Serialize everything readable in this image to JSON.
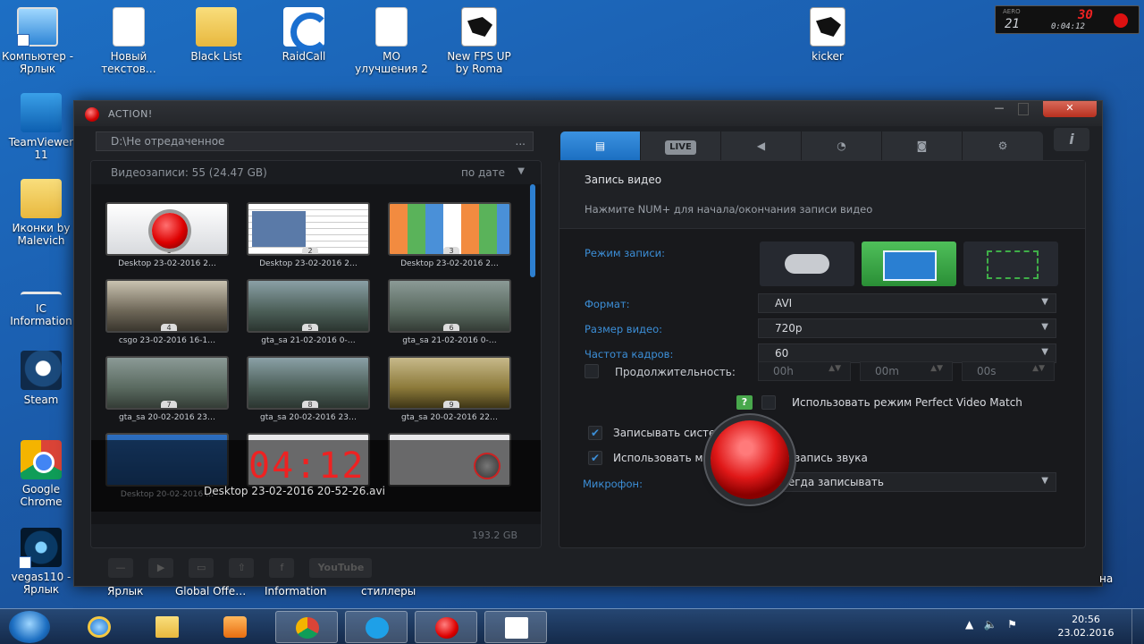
{
  "desktop_icons": [
    {
      "label": "Компьютер -\nЯрлык",
      "icon": "computer-icon"
    },
    {
      "label": "Новый\nтекстов…",
      "icon": "document-icon"
    },
    {
      "label": "Black List",
      "icon": "folder-icon"
    },
    {
      "label": "RaidCall",
      "icon": "raidcall-icon"
    },
    {
      "label": "MO\nулучшения 2",
      "icon": "document-icon"
    },
    {
      "label": "New FPS UP\nby Roma",
      "icon": "kicker-icon"
    },
    {
      "label": "kicker",
      "icon": "kicker-icon"
    },
    {
      "label": "TeamViewer\n11",
      "icon": "teamviewer-icon"
    },
    {
      "label": "Иконки by\nMalevich",
      "icon": "folder-icon"
    },
    {
      "label": "IC\nInformation",
      "icon": "ic-icon"
    },
    {
      "label": "Steam",
      "icon": "steam-icon"
    },
    {
      "label": "Google\nChrome",
      "icon": "chrome-icon"
    },
    {
      "label": "vegas110 -\nЯрлык",
      "icon": "vegas-icon"
    }
  ],
  "behind_labels": [
    "Ярлык",
    "Global Offe…",
    "Information",
    "стиллеры",
    "на"
  ],
  "fps_widget": {
    "aero": "AERO",
    "aero_value": "21",
    "fps": "30",
    "record_time": "0:04:12"
  },
  "window": {
    "title": "ACTION!",
    "path": "D:\\Не отредаченное",
    "path_more": "...",
    "left": {
      "header": "Видеозаписи: 55 (24.47 GB)",
      "sort": "по дате",
      "thumbs": [
        {
          "num": "1",
          "caption": "Desktop 23-02-2016 2…",
          "style": "rec"
        },
        {
          "num": "2",
          "caption": "Desktop 23-02-2016 2…",
          "style": "web"
        },
        {
          "num": "3",
          "caption": "Desktop 23-02-2016 2…",
          "style": "web2"
        },
        {
          "num": "4",
          "caption": "csgo 23-02-2016 16-1…",
          "style": "csgo"
        },
        {
          "num": "5",
          "caption": "gta_sa 21-02-2016 0-…",
          "style": "gta1"
        },
        {
          "num": "6",
          "caption": "gta_sa 21-02-2016 0-…",
          "style": "gta2"
        },
        {
          "num": "7",
          "caption": "gta_sa 20-02-2016 23…",
          "style": "gta2"
        },
        {
          "num": "8",
          "caption": "gta_sa 20-02-2016 23…",
          "style": "gta1"
        },
        {
          "num": "9",
          "caption": "gta_sa 20-02-2016 22…",
          "style": "gta3"
        },
        {
          "num": "",
          "caption": "Desktop 20-02-2016 …",
          "style": "desk"
        },
        {
          "num": "",
          "caption": "",
          "style": "white"
        },
        {
          "num": "",
          "caption": "",
          "style": "white"
        }
      ],
      "overlay_time": "04:12",
      "overlay_file": "Desktop 23-02-2016 20-52-26.avi",
      "disk_free": "193.2 GB",
      "toolbar": [
        "—",
        "▶",
        "▭",
        "⇧",
        "f",
        "YouTube"
      ]
    },
    "right": {
      "tabs": [
        "video",
        "LIVE",
        "audio",
        "timer",
        "screenshot",
        "settings"
      ],
      "title": "Запись видео",
      "hint": "Нажмите NUM+ для начала/окончания записи видео",
      "mode_label": "Режим записи:",
      "format_label": "Формат:",
      "format_value": "AVI",
      "size_label": "Размер видео:",
      "size_value": "720p",
      "fps_label": "Частота кадров:",
      "fps_value": "60",
      "duration_label": "Продолжительность:",
      "duration": [
        "00h",
        "00m",
        "00s"
      ],
      "pvm_label": "Использовать режим Perfect Video Match",
      "help": "?",
      "sys_sound_label": "Записывать системные звуки",
      "multi_label": "Использовать многоканальную запись звука",
      "mic_label": "Микрофон:",
      "mic_value": "Всегда записывать",
      "info": "i"
    }
  },
  "taskbar": {
    "apps": [
      "internet-explorer",
      "explorer",
      "media-player",
      "chrome",
      "skype",
      "action",
      "kicker"
    ],
    "clock_time": "20:56",
    "clock_date": "23.02.2016"
  }
}
